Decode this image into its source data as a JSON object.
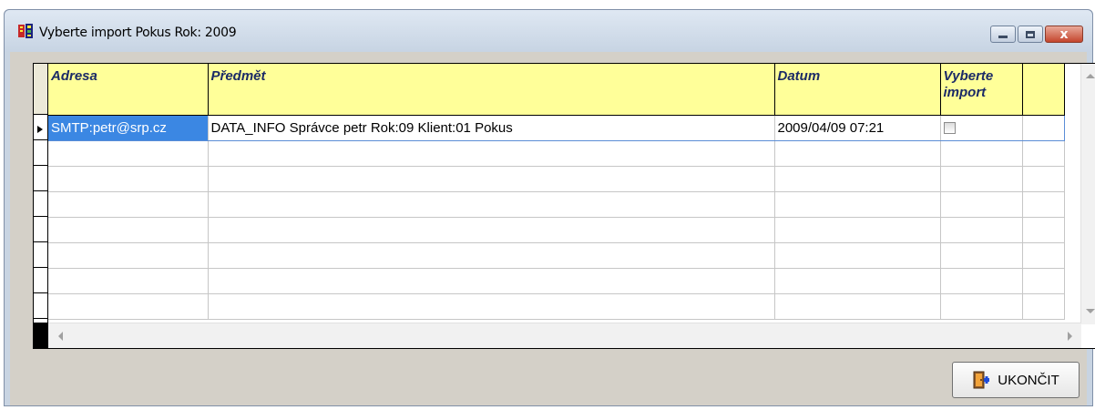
{
  "window": {
    "title": "Vyberte import  Pokus  Rok: 2009",
    "icon": "app-icon"
  },
  "controls": {
    "minimize_icon": "minimize-icon",
    "maximize_icon": "maximize-icon",
    "close_label": "x"
  },
  "grid": {
    "columns": [
      {
        "label": "Adresa",
        "width": 175
      },
      {
        "label": "Předmět",
        "width": 622
      },
      {
        "label": "Datum",
        "width": 182
      },
      {
        "label": "Vyberte\nimport",
        "width": 90
      },
      {
        "label": "",
        "width": 46
      }
    ],
    "rows": [
      {
        "adresa": "SMTP:petr@srp.cz",
        "predmet": "DATA_INFO Správce petr Rok:09  Klient:01 Pokus",
        "datum": "2009/04/09 07:21",
        "vyberte_import": false
      }
    ],
    "empty_rows": 7
  },
  "footer": {
    "end_button_label": "UKONČIT"
  },
  "colors": {
    "header_bg": "#ffff99",
    "header_text": "#1b2a66",
    "selection": "#3b87e3"
  }
}
